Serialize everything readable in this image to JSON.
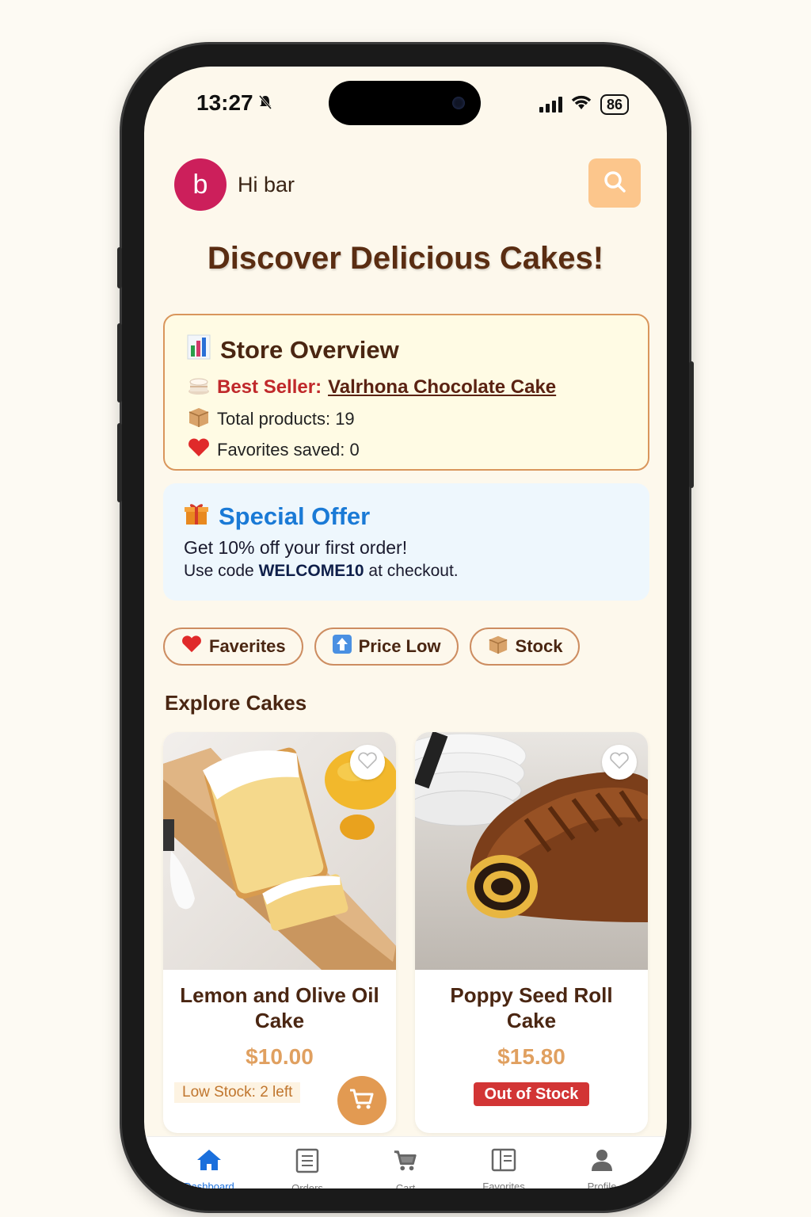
{
  "status_bar": {
    "time": "13:27",
    "battery": "86"
  },
  "header": {
    "avatar_letter": "b",
    "greeting": "Hi bar"
  },
  "page_title": "Discover Delicious Cakes!",
  "overview": {
    "title": "Store Overview",
    "best_seller_label": "Best Seller:",
    "best_seller_name": "Valrhona Chocolate Cake",
    "total_products": "Total products: 19",
    "favorites_saved": "Favorites saved: 0"
  },
  "offer": {
    "title": "Special Offer",
    "line1": "Get 10% off your first order!",
    "line2_prefix": "Use code ",
    "code": "WELCOME10",
    "line2_suffix": " at checkout."
  },
  "filters": [
    {
      "icon": "heart-icon",
      "label": "Faverites"
    },
    {
      "icon": "arrow-up-icon",
      "label": "Price Low"
    },
    {
      "icon": "box-icon",
      "label": "Stock"
    }
  ],
  "section_title": "Explore Cakes",
  "products": [
    {
      "name": "Lemon and Olive Oil Cake",
      "price": "$10.00",
      "stock_text": "Low Stock: 2 left"
    },
    {
      "name": "Poppy Seed Roll Cake",
      "price": "$15.80",
      "stock_text": "Out of Stock"
    }
  ],
  "tabs": [
    {
      "icon": "home-icon",
      "label": "Dashboard",
      "active": true
    },
    {
      "icon": "orders-icon",
      "label": "Orders",
      "active": false
    },
    {
      "icon": "cart-icon",
      "label": "Cart",
      "active": false
    },
    {
      "icon": "favorites-icon",
      "label": "Favorites",
      "active": false
    },
    {
      "icon": "profile-icon",
      "label": "Profile",
      "active": false
    }
  ],
  "colors": {
    "accent_orange": "#e29a52",
    "title_brown": "#5a2d12",
    "offer_blue": "#1a7ad6",
    "best_seller_red": "#c0292b",
    "active_tab_blue": "#1a6fdc"
  }
}
